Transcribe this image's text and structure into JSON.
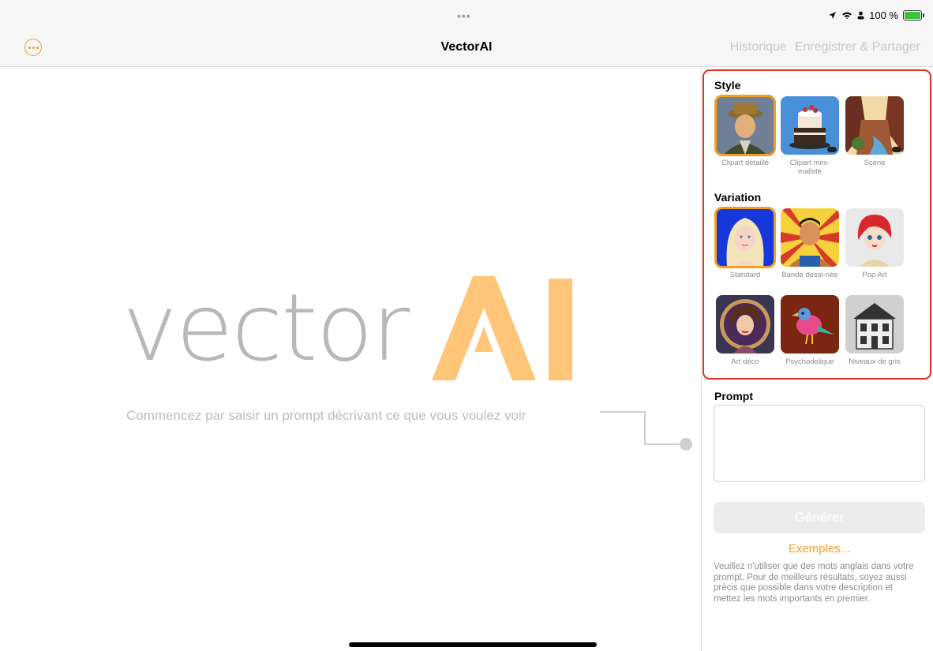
{
  "status_bar": {
    "dots": "•••",
    "battery": "100 %"
  },
  "navbar": {
    "title": "VectorAI",
    "history": "Historique",
    "save_share": "Enregistrer & Partager"
  },
  "canvas": {
    "logo_prefix": "vector",
    "logo_suffix": "AI",
    "hint": "Commencez par saisir un prompt décrivant ce que vous voulez voir"
  },
  "panel": {
    "style_title": "Style",
    "styles": [
      {
        "label": "Clipart détaillé",
        "selected": true
      },
      {
        "label": "Clipart mini-maliste",
        "selected": false
      },
      {
        "label": "Scène",
        "selected": false
      }
    ],
    "variation_title": "Variation",
    "variations": [
      {
        "label": "Standard",
        "selected": true
      },
      {
        "label": "Bande dessi-née",
        "selected": false
      },
      {
        "label": "Pop Art",
        "selected": false
      },
      {
        "label": "Art déco",
        "selected": false
      },
      {
        "label": "Psychodelique",
        "selected": false
      },
      {
        "label": "Niveaux de gris",
        "selected": false
      }
    ],
    "prompt_label": "Prompt",
    "prompt_value": "",
    "generate": "Générer",
    "examples": "Exemples...",
    "note": "Veuillez n'utiliser que des mots anglais dans votre prompt. Pour de meilleurs résultats, soyez aussi précis que possible dans votre description et mettez les mots importants en premier."
  },
  "colors": {
    "accent": "#f2a023",
    "highlight": "#e0301e",
    "logo_gray": "#b8b8b8",
    "logo_orange": "#ffc67a"
  }
}
